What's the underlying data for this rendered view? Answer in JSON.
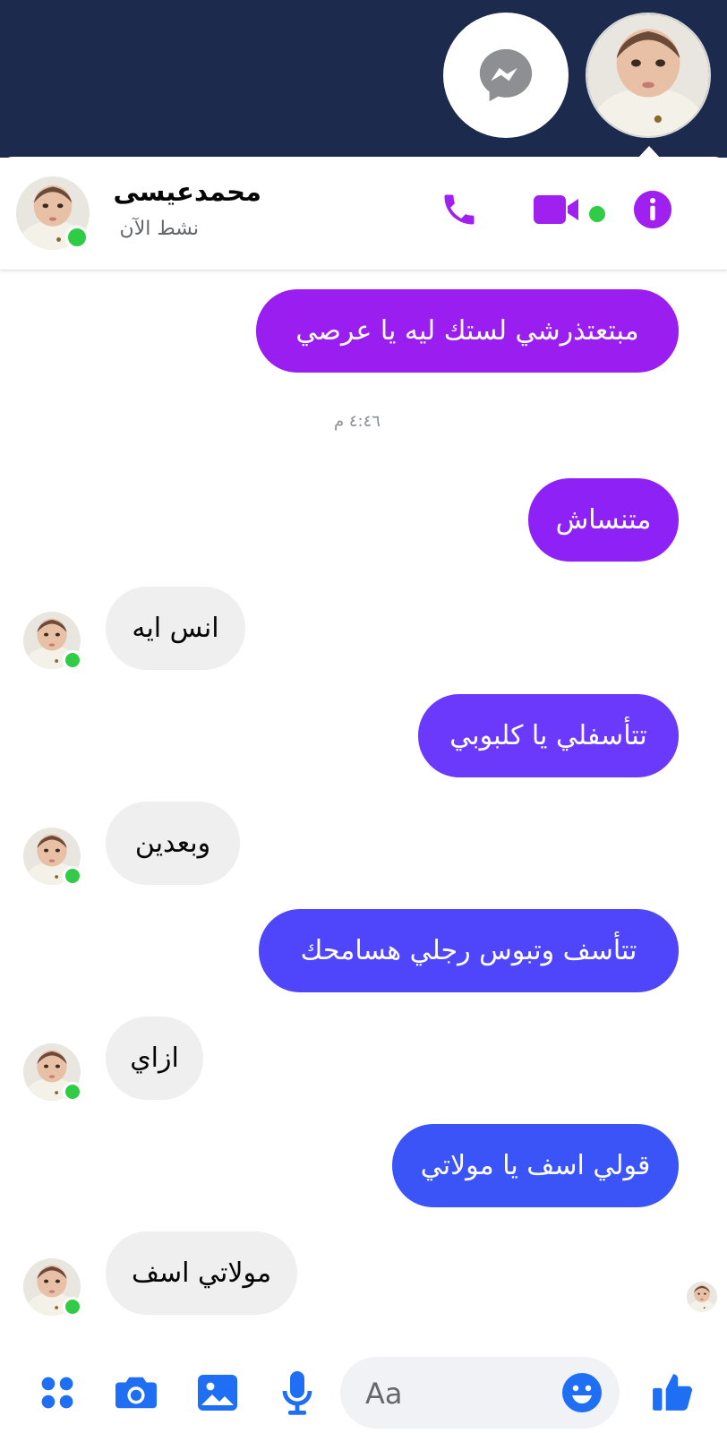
{
  "header": {
    "contact_name": "محمدعيسى",
    "status": "نشط الآن"
  },
  "messages": [
    {
      "side": "out",
      "text": "مبتعتذرشي لستك ليه يا عرصي",
      "color": "#9b1ef0"
    },
    {
      "side": "out",
      "text": "متنساش",
      "color": "#8e22f6"
    },
    {
      "side": "in",
      "text": "انس ايه"
    },
    {
      "side": "out",
      "text": "تتأسفلي يا كلبوبي",
      "color": "#6b39fb"
    },
    {
      "side": "in",
      "text": "وبعدين"
    },
    {
      "side": "out",
      "text": "تتأسف وتبوس رجلي هسامحك",
      "color": "#4f46fb"
    },
    {
      "side": "in",
      "text": "ازاي"
    },
    {
      "side": "out",
      "text": "قولي اسف يا مولاتي",
      "color": "#3b54f7"
    },
    {
      "side": "in",
      "text": "مولاتي اسف"
    }
  ],
  "timestamp": "٤:٤٦ م",
  "composer": {
    "placeholder": "Aa"
  },
  "colors": {
    "topbar": "#1c2b4d",
    "header_icons": "#a020f0",
    "composer_icons": "#1f6ff5",
    "online": "#31cc46"
  },
  "icons": {
    "messenger": "messenger-icon",
    "call": "phone-icon",
    "video": "video-camera-icon",
    "info": "info-icon",
    "apps": "apps-icon",
    "camera": "camera-icon",
    "gallery": "image-icon",
    "mic": "microphone-icon",
    "emoji": "emoji-icon",
    "like": "thumbs-up-icon"
  }
}
